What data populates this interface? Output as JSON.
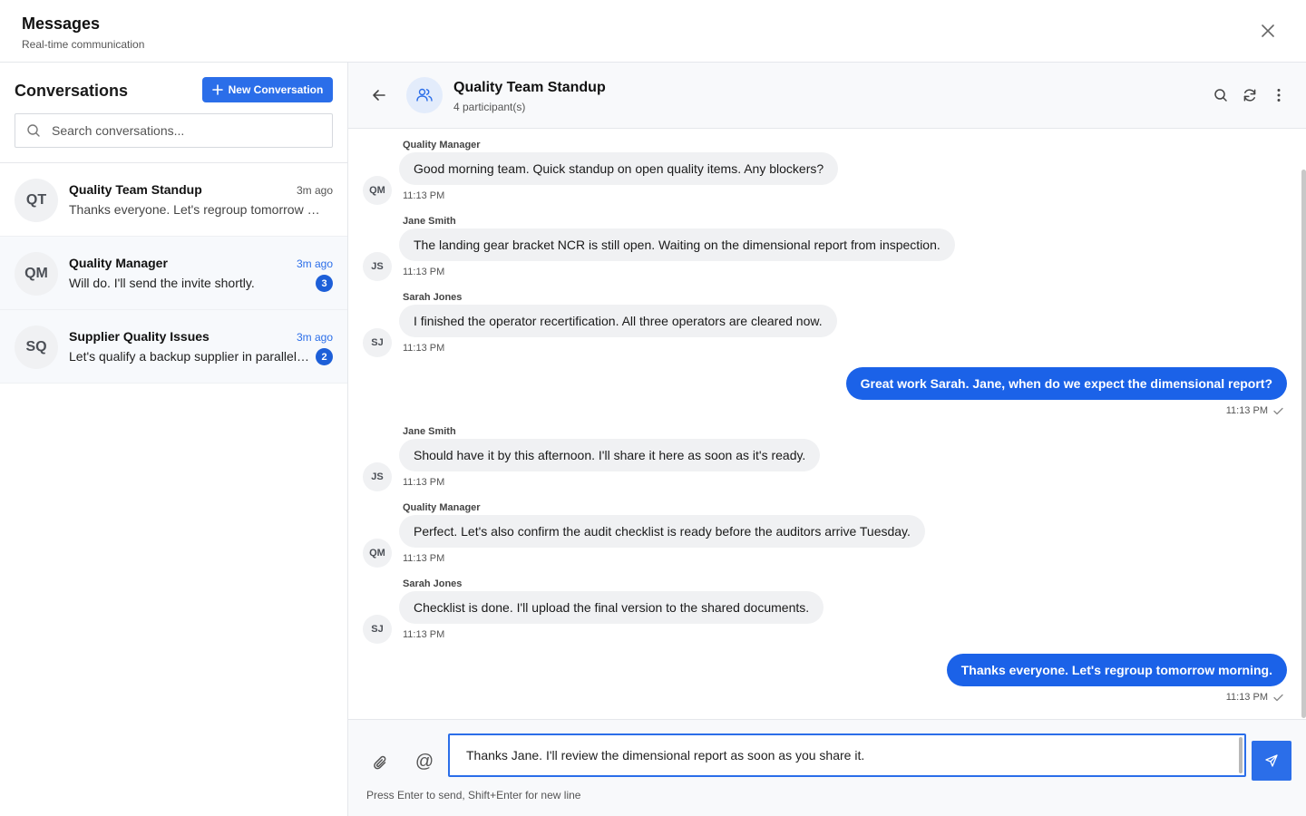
{
  "app": {
    "title": "Messages",
    "subtitle": "Real-time communication"
  },
  "sidebar": {
    "title": "Conversations",
    "new_button_label": "New Conversation",
    "search_placeholder": "Search conversations...",
    "conversations": [
      {
        "initials": "QT",
        "name": "Quality Team Standup",
        "time": "3m ago",
        "preview": "Thanks everyone. Let's regroup tomorrow morning.",
        "unread": null
      },
      {
        "initials": "QM",
        "name": "Quality Manager",
        "time": "3m ago",
        "preview": "Will do. I'll send the invite shortly.",
        "unread": "3"
      },
      {
        "initials": "SQ",
        "name": "Supplier Quality Issues",
        "time": "3m ago",
        "preview": "Let's qualify a backup supplier in parallel. We cannot",
        "unread": "2"
      }
    ]
  },
  "chat": {
    "title": "Quality Team Standup",
    "participants": "4 participant(s)",
    "messages": [
      {
        "sender": "Quality Manager",
        "initials": "QM",
        "text": "Good morning team. Quick standup on open quality items. Any blockers?",
        "time": "11:13 PM"
      },
      {
        "sender": "Jane Smith",
        "initials": "JS",
        "text": "The landing gear bracket NCR is still open. Waiting on the dimensional report from inspection.",
        "time": "11:13 PM"
      },
      {
        "sender": "Sarah Jones",
        "initials": "SJ",
        "text": "I finished the operator recertification. All three operators are cleared now.",
        "time": "11:13 PM"
      },
      {
        "sender": "",
        "initials": "",
        "text": "Great work Sarah. Jane, when do we expect the dimensional report?",
        "time": "11:13 PM"
      },
      {
        "sender": "Jane Smith",
        "initials": "JS",
        "text": "Should have it by this afternoon. I'll share it here as soon as it's ready.",
        "time": "11:13 PM"
      },
      {
        "sender": "Quality Manager",
        "initials": "QM",
        "text": "Perfect. Let's also confirm the audit checklist is ready before the auditors arrive Tuesday.",
        "time": "11:13 PM"
      },
      {
        "sender": "Sarah Jones",
        "initials": "SJ",
        "text": "Checklist is done. I'll upload the final version to the shared documents.",
        "time": "11:13 PM"
      },
      {
        "sender": "",
        "initials": "",
        "text": "Thanks everyone. Let's regroup tomorrow morning.",
        "time": "11:13 PM"
      }
    ]
  },
  "composer": {
    "value": "Thanks Jane. I'll review the dimensional report as soon as you share it.",
    "mention_symbol": "@",
    "hint": "Press Enter to send, Shift+Enter for new line"
  },
  "icons": {
    "close": "close-icon",
    "plus": "plus-icon",
    "search": "search-icon",
    "back": "arrow-left-icon",
    "group": "users-icon",
    "refresh": "refresh-icon",
    "more": "more-vertical-icon",
    "attach": "paperclip-icon",
    "send": "send-icon",
    "read": "check-icon"
  },
  "colors": {
    "accent": "#2b6ee9",
    "outgoing_bubble": "#1b62e8",
    "incoming_bubble": "#f0f1f3",
    "badge": "#1d5fd8"
  }
}
